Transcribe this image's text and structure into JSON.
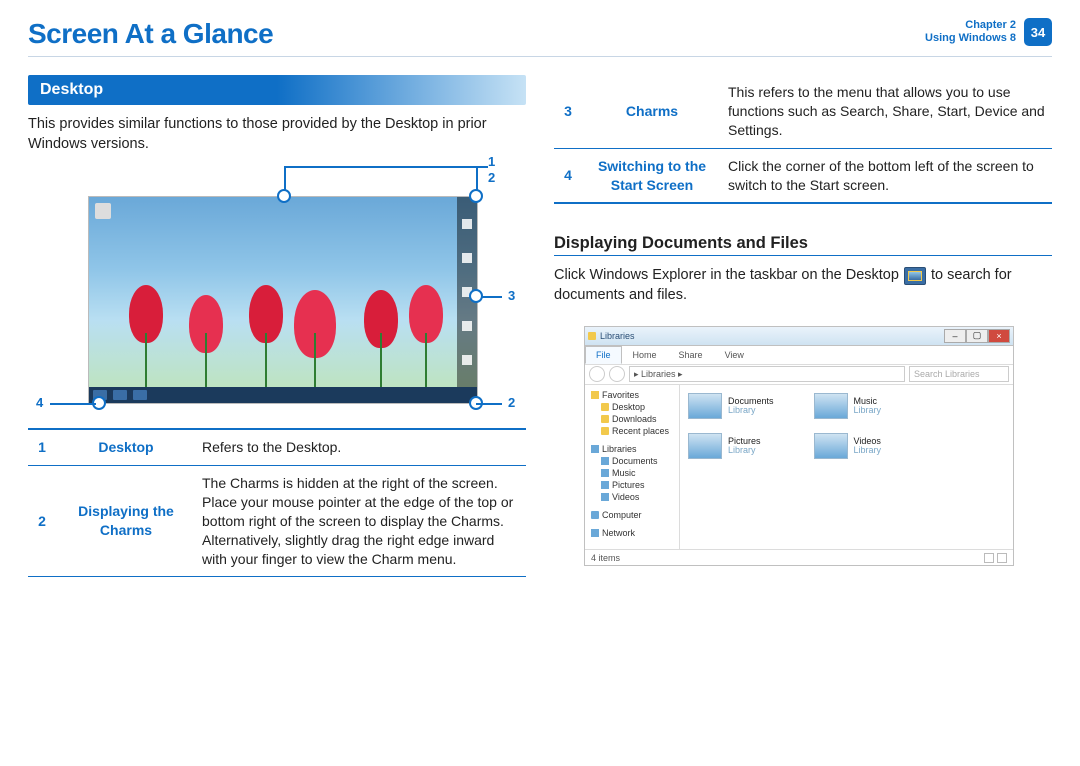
{
  "header": {
    "title": "Screen At a Glance",
    "chapter_line1": "Chapter 2",
    "chapter_line2": "Using Windows 8",
    "page_number": "34"
  },
  "desktop_section": {
    "banner": "Desktop",
    "intro": "This provides similar functions to those provided by the Desktop in prior Windows versions."
  },
  "callouts": {
    "n1": "1",
    "n2": "2",
    "n3": "3",
    "n4": "4"
  },
  "defs": [
    {
      "num": "1",
      "label": "Desktop",
      "desc": "Refers to the Desktop."
    },
    {
      "num": "2",
      "label": "Displaying the Charms",
      "desc": "The Charms is hidden at the right of the screen. Place your mouse pointer at the edge of the top or bottom right of the screen to display the Charms.\nAlternatively, slightly drag the right edge inward with your finger to view the Charm menu."
    },
    {
      "num": "3",
      "label": "Charms",
      "desc": "This refers to the menu that allows you to use functions such as Search, Share, Start, Device and Settings."
    },
    {
      "num": "4",
      "label": "Switching to the Start Screen",
      "desc": "Click the corner of the bottom left of the screen to switch to the Start screen."
    }
  ],
  "files_section": {
    "heading": "Displaying Documents and Files",
    "text_before": "Click Windows Explorer in the taskbar on the Desktop ",
    "text_after": " to search for documents and files."
  },
  "explorer": {
    "title": "Libraries",
    "tabs": {
      "file": "File",
      "home": "Home",
      "share": "Share",
      "view": "View"
    },
    "path": "▸ Libraries ▸",
    "search_placeholder": "Search Libraries",
    "side": {
      "favorites": "Favorites",
      "desktop": "Desktop",
      "downloads": "Downloads",
      "recent": "Recent places",
      "libraries": "Libraries",
      "documents": "Documents",
      "music": "Music",
      "pictures": "Pictures",
      "videos": "Videos",
      "computer": "Computer",
      "network": "Network"
    },
    "libs": {
      "documents": "Documents",
      "music": "Music",
      "pictures": "Pictures",
      "videos": "Videos",
      "subtype": "Library"
    },
    "status": "4 items"
  }
}
